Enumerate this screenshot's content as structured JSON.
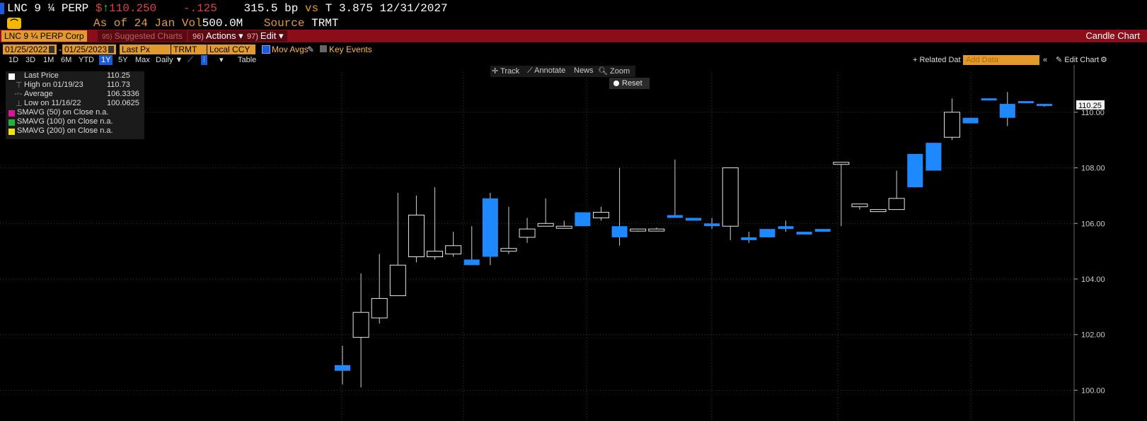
{
  "header": {
    "ticker": "LNC 9 ¼ PERP",
    "price_prefix": "$",
    "price": "110.250",
    "change": "-.125",
    "spread": "315.5 bp",
    "vs": "vs",
    "benchmark": "T 3.875 12/31/2027",
    "as_of_label": "As of",
    "as_of_date": "24 Jan",
    "vol_label": "Vol",
    "volume": "500.0M",
    "source_label": "Source",
    "source": "TRMT"
  },
  "function_bar": {
    "security": "LNC 9 ¼ PERP Corp",
    "suggested": "Suggested Charts",
    "actions_num": "96)",
    "actions_label": "Actions",
    "edit_num": "97)",
    "edit_label": "Edit",
    "chart_title": "Candle Chart"
  },
  "controls": {
    "start_date": "01/25/2022",
    "end_date": "01/25/2023",
    "field": "Last Px",
    "source": "TRMT",
    "currency": "Local CCY",
    "mov_avgs": "Mov Avgs",
    "key_events": "Key Events",
    "ranges": [
      "1D",
      "3D",
      "1M",
      "6M",
      "YTD",
      "1Y",
      "5Y",
      "Max"
    ],
    "selected_range": "1Y",
    "frequency": "Daily",
    "table_label": "Table",
    "related_data": "Related Dat",
    "add_data_placeholder": "Add Data",
    "edit_chart": "Edit Chart"
  },
  "chart_toolbar": {
    "track": "Track",
    "annotate": "Annotate",
    "news": "News",
    "zoom": "Zoom",
    "reset": "Reset"
  },
  "legend": {
    "rows": [
      {
        "label": "Last Price",
        "value": "110.25"
      },
      {
        "label": "High on 01/19/23",
        "value": "110.73"
      },
      {
        "label": "Average",
        "value": "106.3336"
      },
      {
        "label": "Low on 11/16/22",
        "value": "100.0625"
      },
      {
        "label": "SMAVG (50)  on Close",
        "value": "n.a."
      },
      {
        "label": "SMAVG (100)  on Close",
        "value": "n.a."
      },
      {
        "label": "SMAVG (200)  on Close",
        "value": "n.a."
      }
    ],
    "colors": [
      "#ffffff",
      "#888888",
      "#888888",
      "#888888",
      "#e0139c",
      "#1fb53a",
      "#f5e400"
    ]
  },
  "colors": {
    "up": "#000000",
    "down": "#1e88ff",
    "accent_red": "#8b0d1a",
    "field_orange": "#e39a2d"
  },
  "chart_data": {
    "type": "candlestick",
    "y_axis_ticks": [
      "100.00",
      "102.00",
      "104.00",
      "106.00",
      "108.00",
      "110.00"
    ],
    "ylim": [
      99.4,
      111.7
    ],
    "last_value_label": "110.25",
    "grid": true,
    "candles": [
      {
        "o": 100.9,
        "h": 101.6,
        "l": 100.2,
        "c": 100.7
      },
      {
        "o": 101.9,
        "h": 104.2,
        "l": 100.1,
        "c": 102.8
      },
      {
        "o": 102.6,
        "h": 104.9,
        "l": 102.4,
        "c": 103.3
      },
      {
        "o": 103.4,
        "h": 107.1,
        "l": 103.4,
        "c": 104.5
      },
      {
        "o": 104.8,
        "h": 107.0,
        "l": 104.6,
        "c": 106.3
      },
      {
        "o": 104.8,
        "h": 107.3,
        "l": 104.7,
        "c": 105.0
      },
      {
        "o": 104.9,
        "h": 105.7,
        "l": 104.8,
        "c": 105.2
      },
      {
        "o": 104.7,
        "h": 105.9,
        "l": 104.5,
        "c": 104.5
      },
      {
        "o": 106.9,
        "h": 107.1,
        "l": 104.5,
        "c": 104.8
      },
      {
        "o": 105.0,
        "h": 106.6,
        "l": 104.9,
        "c": 105.1
      },
      {
        "o": 105.5,
        "h": 106.2,
        "l": 105.3,
        "c": 105.8
      },
      {
        "o": 105.9,
        "h": 106.9,
        "l": 105.9,
        "c": 106.0
      },
      {
        "o": 105.9,
        "h": 106.1,
        "l": 105.85,
        "c": 105.9
      },
      {
        "o": 106.4,
        "h": 106.4,
        "l": 105.9,
        "c": 105.9
      },
      {
        "o": 106.2,
        "h": 106.6,
        "l": 106.1,
        "c": 106.4
      },
      {
        "o": 105.9,
        "h": 108.0,
        "l": 105.2,
        "c": 105.5
      },
      {
        "o": 105.75,
        "h": 105.8,
        "l": 105.7,
        "c": 105.8
      },
      {
        "o": 105.8,
        "h": 105.85,
        "l": 105.75,
        "c": 105.8
      },
      {
        "o": 106.3,
        "h": 108.3,
        "l": 106.2,
        "c": 106.2
      },
      {
        "o": 106.2,
        "h": 106.2,
        "l": 106.1,
        "c": 106.1
      },
      {
        "o": 106.0,
        "h": 106.2,
        "l": 105.8,
        "c": 105.9
      },
      {
        "o": 105.9,
        "h": 108.0,
        "l": 105.4,
        "c": 108.0
      },
      {
        "o": 105.5,
        "h": 105.7,
        "l": 105.3,
        "c": 105.4
      },
      {
        "o": 105.8,
        "h": 105.8,
        "l": 105.5,
        "c": 105.5
      },
      {
        "o": 105.9,
        "h": 106.1,
        "l": 105.7,
        "c": 105.8
      },
      {
        "o": 105.7,
        "h": 105.7,
        "l": 105.6,
        "c": 105.6
      },
      {
        "o": 105.8,
        "h": 105.8,
        "l": 105.7,
        "c": 105.7
      },
      {
        "o": 108.2,
        "h": 108.2,
        "l": 105.9,
        "c": 108.2
      },
      {
        "o": 106.6,
        "h": 106.7,
        "l": 106.5,
        "c": 106.7
      },
      {
        "o": 106.5,
        "h": 106.5,
        "l": 106.45,
        "c": 106.5
      },
      {
        "o": 106.5,
        "h": 107.9,
        "l": 106.5,
        "c": 106.9
      },
      {
        "o": 108.5,
        "h": 108.5,
        "l": 107.3,
        "c": 107.3
      },
      {
        "o": 108.9,
        "h": 108.9,
        "l": 107.9,
        "c": 107.9
      },
      {
        "o": 109.1,
        "h": 110.5,
        "l": 109.0,
        "c": 110.0
      },
      {
        "o": 109.8,
        "h": 109.8,
        "l": 109.6,
        "c": 109.6
      },
      {
        "o": 110.5,
        "h": 110.5,
        "l": 110.45,
        "c": 110.45
      },
      {
        "o": 110.3,
        "h": 110.73,
        "l": 109.5,
        "c": 109.8
      },
      {
        "o": 110.4,
        "h": 110.4,
        "l": 110.35,
        "c": 110.35
      },
      {
        "o": 110.3,
        "h": 110.3,
        "l": 110.2,
        "c": 110.25
      }
    ]
  }
}
